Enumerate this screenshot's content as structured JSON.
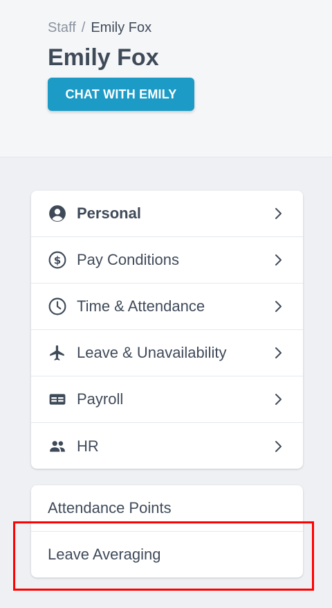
{
  "breadcrumb": {
    "root": "Staff",
    "separator": "/",
    "current": "Emily Fox"
  },
  "page_title": "Emily Fox",
  "chat_button": {
    "label": "CHAT WITH EMILY"
  },
  "menu": {
    "items": [
      {
        "label": "Personal",
        "icon": "person-circle-icon",
        "active": true
      },
      {
        "label": "Pay Conditions",
        "icon": "dollar-circle-icon"
      },
      {
        "label": "Time & Attendance",
        "icon": "clock-icon"
      },
      {
        "label": "Leave & Unavailability",
        "icon": "airplane-icon"
      },
      {
        "label": "Payroll",
        "icon": "payroll-card-icon"
      },
      {
        "label": "HR",
        "icon": "people-icon"
      }
    ]
  },
  "extra_menu": {
    "items": [
      {
        "label": "Attendance Points"
      },
      {
        "label": "Leave Averaging"
      }
    ]
  },
  "colors": {
    "accent": "#1c9bc6",
    "text": "#3f4a59",
    "highlight": "#ff0000"
  }
}
